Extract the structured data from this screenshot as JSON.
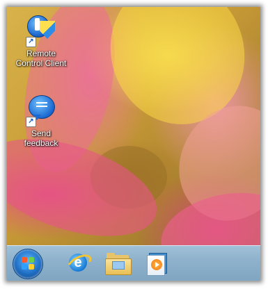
{
  "desktop": {
    "icons": [
      {
        "label": "Remote\nControl Client",
        "icon": "remote-control-client-icon",
        "shortcut": true
      },
      {
        "label": "Send\nfeedback",
        "icon": "feedback-bubble-icon",
        "shortcut": true
      }
    ]
  },
  "taskbar": {
    "start": {
      "icon": "windows-start-orb-icon"
    },
    "pinned": [
      {
        "icon": "internet-explorer-icon"
      },
      {
        "icon": "file-explorer-folder-icon"
      },
      {
        "icon": "media-player-icon"
      }
    ]
  },
  "colors": {
    "taskbar": "#8fb2cc",
    "icon_label": "#ffffff"
  }
}
